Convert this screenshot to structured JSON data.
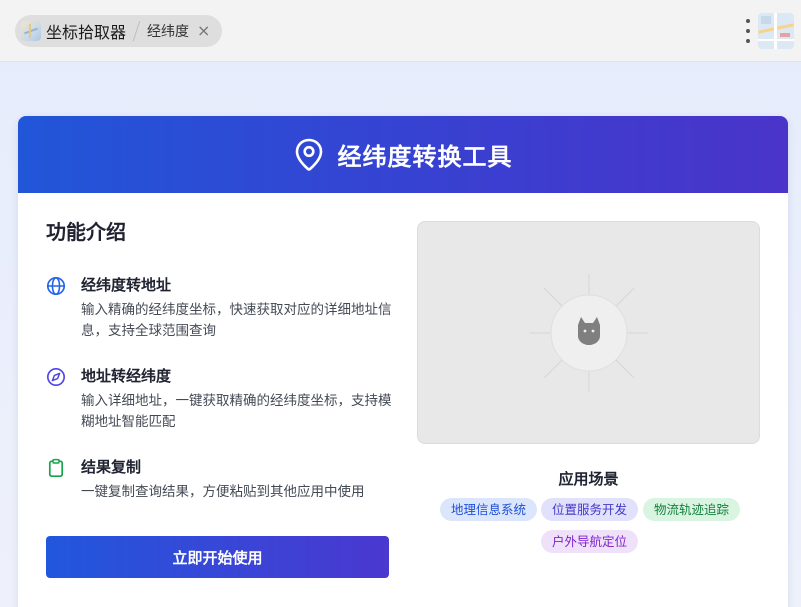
{
  "tabs": {
    "app_label": "坐标拾取器",
    "sub_label": "经纬度",
    "close_symbol": "×"
  },
  "card": {
    "title": "经纬度转换工具",
    "header_icon": "map-pin-icon"
  },
  "intro": {
    "title": "功能介绍",
    "features": [
      {
        "icon": "globe-icon",
        "title": "经纬度转地址",
        "desc": "输入精确的经纬度坐标，快速获取对应的详细地址信息，支持全球范围查询"
      },
      {
        "icon": "compass-icon",
        "title": "地址转经纬度",
        "desc": "输入详细地址，一键获取精确的经纬度坐标，支持模糊地址智能匹配"
      },
      {
        "icon": "clipboard-icon",
        "title": "结果复制",
        "desc": "一键复制查询结果，方便粘贴到其他应用中使用"
      }
    ],
    "start_button": "立即开始使用"
  },
  "scenarios": {
    "title": "应用场景",
    "tags": [
      {
        "label": "地理信息系统",
        "color": "#1d4ed8",
        "bg": "#dbe6fd"
      },
      {
        "label": "位置服务开发",
        "color": "#4338ca",
        "bg": "#e2e1fb"
      },
      {
        "label": "物流轨迹追踪",
        "color": "#15803d",
        "bg": "#d9f5e1"
      },
      {
        "label": "户外导航定位",
        "color": "#7e22ce",
        "bg": "#f0e1fb"
      }
    ]
  },
  "colors": {
    "accent_start": "#2156d9",
    "accent_end": "#4a34c9"
  }
}
